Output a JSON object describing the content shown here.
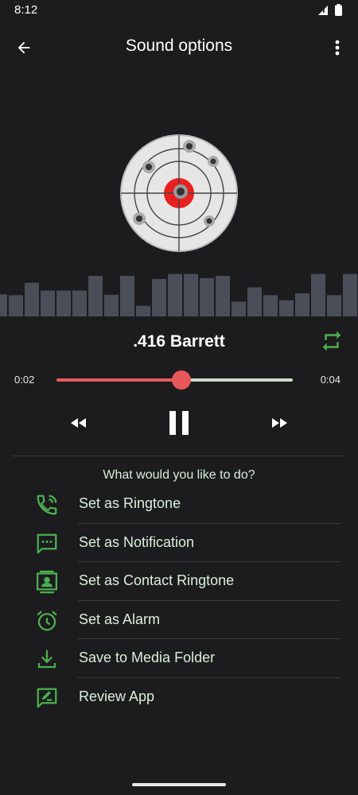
{
  "status_bar": {
    "time": "8:12"
  },
  "app_bar": {
    "title": "Sound options"
  },
  "player": {
    "track_title": ".416 Barrett",
    "current_time": "0:02",
    "total_time": "0:04",
    "progress": 0.53,
    "waveform_levels": [
      0.48,
      0.46,
      0.73,
      0.56,
      0.56,
      0.56,
      0.88,
      0.47,
      0.88,
      0.23,
      0.81,
      0.92,
      0.92,
      0.83,
      0.88,
      0.32,
      0.63,
      0.46,
      0.35,
      0.5,
      0.92,
      0.46,
      0.92
    ]
  },
  "prompt": {
    "question": "What would you like to do?"
  },
  "actions": [
    {
      "label": "Set as Ringtone",
      "icon": "phone-ring-icon"
    },
    {
      "label": "Set as Notification",
      "icon": "message-dots-icon"
    },
    {
      "label": "Set as Contact Ringtone",
      "icon": "contact-card-icon"
    },
    {
      "label": "Set as Alarm",
      "icon": "alarm-clock-icon"
    },
    {
      "label": "Save to Media Folder",
      "icon": "download-icon"
    },
    {
      "label": "Review App",
      "icon": "rate-review-icon"
    }
  ],
  "colors": {
    "background": "#1c1c1e",
    "accent_green": "#4caf50",
    "seek_played": "#e45c5c",
    "seek_remaining": "#c9dcc9",
    "action_text": "#d9f0d9",
    "waveform_bar": "#4a4e59"
  }
}
